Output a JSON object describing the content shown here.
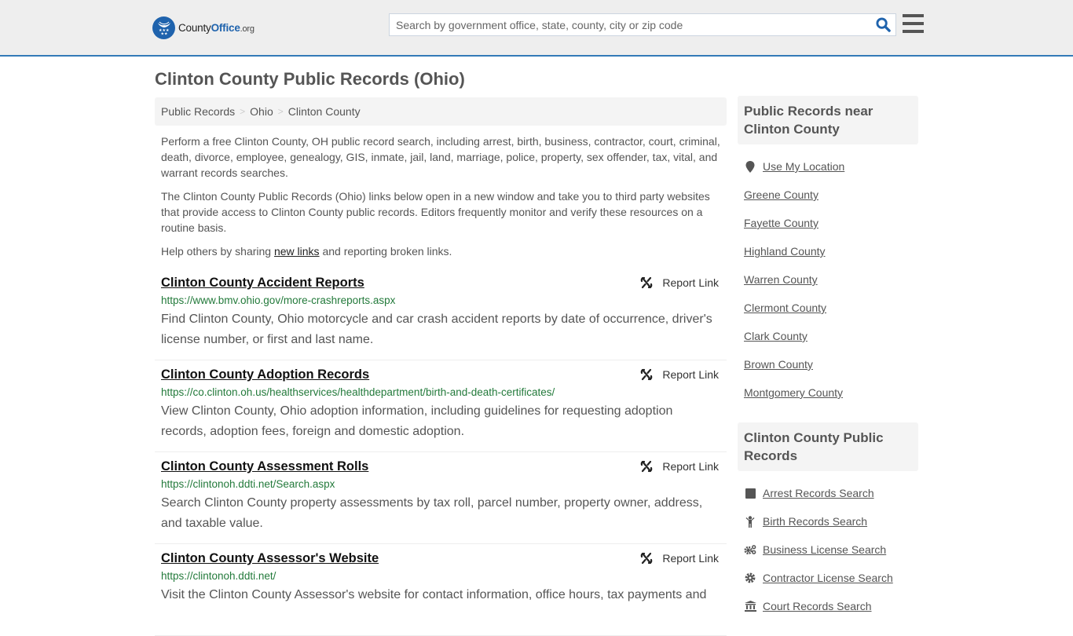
{
  "header": {
    "logo": {
      "part1": "County",
      "part2": "Office",
      "tld": ".org"
    },
    "search": {
      "placeholder": "Search by government office, state, county, city or zip code",
      "value": ""
    },
    "colors": {
      "brand": "#1f63ad",
      "header_bg": "#eeeeee",
      "header_border": "#337ab7"
    }
  },
  "page": {
    "title": "Clinton County Public Records (Ohio)"
  },
  "breadcrumb": [
    {
      "label": "Public Records"
    },
    {
      "label": "Ohio"
    },
    {
      "label": "Clinton County"
    }
  ],
  "breadcrumb_separator": ">",
  "intro": {
    "p1": "Perform a free Clinton County, OH public record search, including arrest, birth, business, contractor, court, criminal, death, divorce, employee, genealogy, GIS, inmate, jail, land, marriage, police, property, sex offender, tax, vital, and warrant records searches.",
    "p2": "The Clinton County Public Records (Ohio) links below open in a new window and take you to third party websites that provide access to Clinton County public records. Editors frequently monitor and verify these resources on a routine basis.",
    "p3_before": "Help others by sharing ",
    "p3_link": "new links",
    "p3_after": " and reporting broken links."
  },
  "report_label": "Report Link",
  "records": [
    {
      "title": "Clinton County Accident Reports",
      "url": "https://www.bmv.ohio.gov/more-crashreports.aspx",
      "description": "Find Clinton County, Ohio motorcycle and car crash accident reports by date of occurrence, driver's license number, or first and last name."
    },
    {
      "title": "Clinton County Adoption Records",
      "url": "https://co.clinton.oh.us/healthservices/healthdepartment/birth-and-death-certificates/",
      "description": "View Clinton County, Ohio adoption information, including guidelines for requesting adoption records, adoption fees, foreign and domestic adoption."
    },
    {
      "title": "Clinton County Assessment Rolls",
      "url": "https://clintonoh.ddti.net/Search.aspx",
      "description": "Search Clinton County property assessments by tax roll, parcel number, property owner, address, and taxable value."
    },
    {
      "title": "Clinton County Assessor's Website",
      "url": "https://clintonoh.ddti.net/",
      "description": "Visit the Clinton County Assessor's website for contact information, office hours, tax payments and"
    }
  ],
  "sidebar": {
    "nearby_heading": "Public Records near Clinton County",
    "use_location": {
      "label": "Use My Location",
      "icon": "map-marker-icon"
    },
    "nearby": [
      "Greene County",
      "Fayette County",
      "Highland County",
      "Warren County",
      "Clermont County",
      "Clark County",
      "Brown County",
      "Montgomery County"
    ],
    "records_heading": "Clinton County Public Records",
    "record_links": [
      {
        "label": "Arrest Records Search",
        "icon": "arrest-icon"
      },
      {
        "label": "Birth Records Search",
        "icon": "child-icon"
      },
      {
        "label": "Business License Search",
        "icon": "gears-icon"
      },
      {
        "label": "Contractor License Search",
        "icon": "gear-icon"
      },
      {
        "label": "Court Records Search",
        "icon": "courthouse-icon"
      }
    ]
  }
}
